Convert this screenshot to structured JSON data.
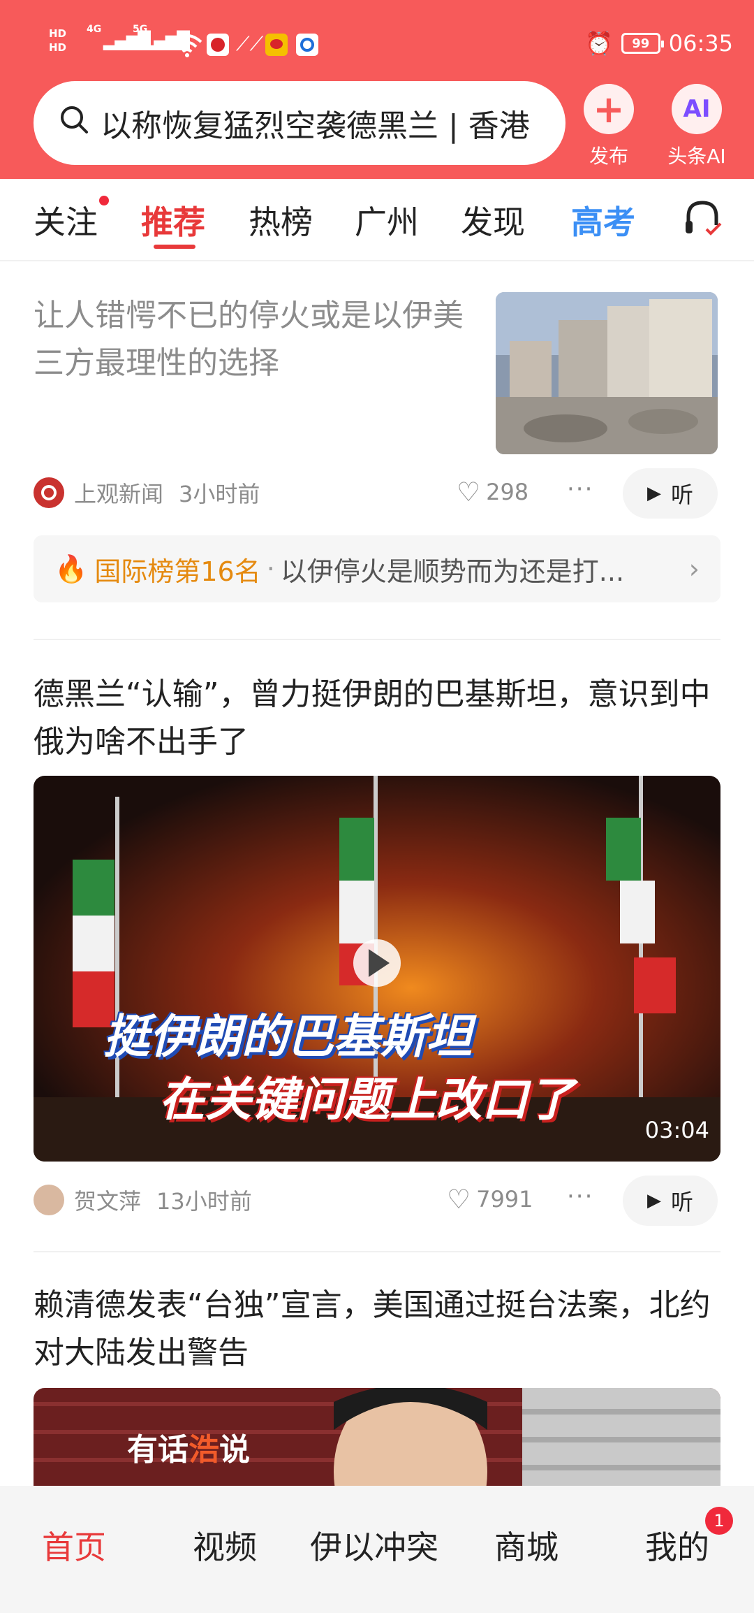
{
  "status_bar": {
    "hd1": "HD",
    "hd2": "HD",
    "sim1": "4G",
    "sim2": "5G",
    "battery": "99",
    "time": "06:35"
  },
  "header": {
    "search_text": "以称恢复猛烈空袭德黑兰 | 香港",
    "publish_label": "发布",
    "ai_label": "头条AI",
    "ai_icon_text": "AI",
    "publish_icon": "+"
  },
  "tabs": [
    "关注",
    "推荐",
    "热榜",
    "广州",
    "发现",
    "高考"
  ],
  "articles": [
    {
      "title": "让人错愕不已的停火或是以伊美三方最理性的选择",
      "source": "上观新闻",
      "time": "3小时前",
      "likes": "298",
      "listen": "听"
    },
    {
      "title": "德黑兰“认输”，曾力挺伊朗的巴基斯坦，意识到中俄为啥不出手了",
      "source": "贺文萍",
      "time": "13小时前",
      "likes": "7991",
      "listen": "听",
      "video_caption_1": "挺伊朗的巴基斯坦",
      "video_caption_2": "在关键问题上改口了",
      "duration": "03:04"
    },
    {
      "title": "赖清德发表“台独”宣言，美国通过挺台法案，北约对大陆发出警告",
      "thumb_text_1": "有话",
      "thumb_text_2": "浩",
      "thumb_text_3": "说"
    }
  ],
  "hot_bar": {
    "rank": "国际榜第16名",
    "sep": "·",
    "topic": "以伊停火是顺势而为还是打..."
  },
  "bottom_nav": [
    "首页",
    "视频",
    "伊以冲突",
    "商城",
    "我的"
  ],
  "bottom_badge": "1",
  "colors": {
    "brand": "#f75a5a",
    "accent": "#e8393a",
    "gaokao": "#3b8ff5"
  }
}
